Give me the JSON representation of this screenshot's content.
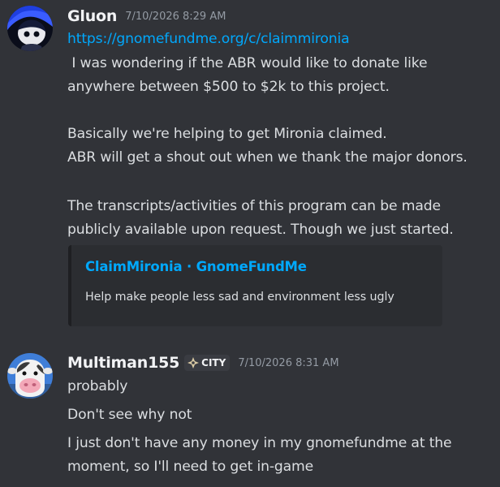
{
  "messages": [
    {
      "author": "Gluon",
      "avatar_icon": "avatar-icon",
      "timestamp": "7/10/2026 8:29 AM",
      "link": "https://gnomefundme.org/c/claimmironia",
      "lines": [
        " I was wondering if the ABR would like to donate like",
        "anywhere between $500 to $2k to this project.",
        "Basically we're helping to get Mironia claimed.",
        "ABR will get a shout out when we thank the major donors.",
        "The transcripts/activities of this program can be made",
        "publicly available upon request. Though we just started."
      ],
      "embed": {
        "title": "ClaimMironia · GnomeFundMe",
        "description": "Help make people less sad and environment less ugly",
        "accent_color": "#1e1f22"
      }
    },
    {
      "author": "Multiman155",
      "avatar_icon": "cow-avatar-icon",
      "tag": {
        "icon": "compass-icon",
        "label": "CITY"
      },
      "timestamp": "7/10/2026 8:31 AM",
      "lines": [
        "probably",
        "Don't see why not",
        "I just don't have any money in my gnomefundme at the",
        "moment, so I'll need to get in-game"
      ]
    }
  ],
  "colors": {
    "background": "#313338",
    "link": "#00a8fc",
    "text": "#dbdee1",
    "muted": "#949ba4"
  }
}
